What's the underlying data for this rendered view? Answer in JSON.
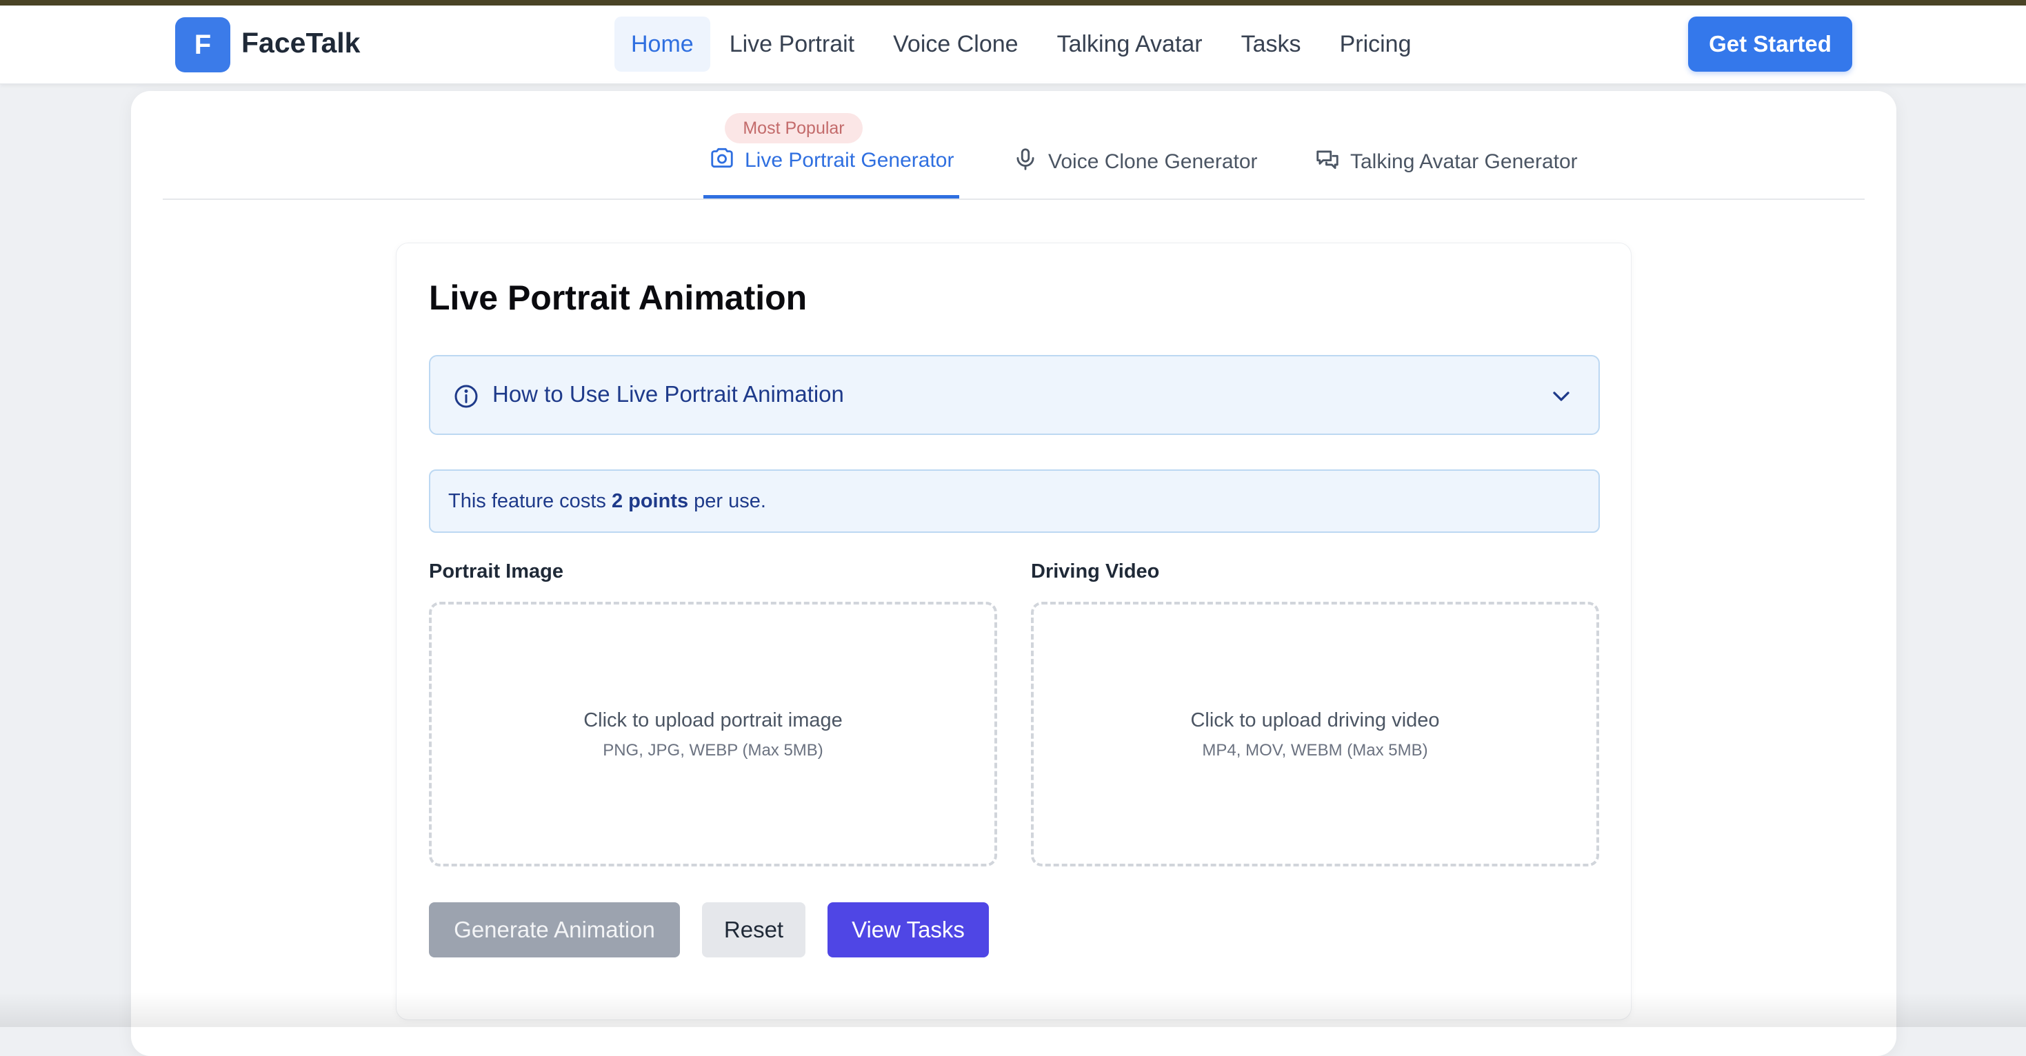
{
  "brand": {
    "logo_letter": "F",
    "name": "FaceTalk",
    "accent": "#3478eb"
  },
  "nav": {
    "links": [
      {
        "label": "Home",
        "active": true
      },
      {
        "label": "Live Portrait"
      },
      {
        "label": "Voice Clone"
      },
      {
        "label": "Talking Avatar"
      },
      {
        "label": "Tasks"
      },
      {
        "label": "Pricing"
      }
    ],
    "cta": "Get Started"
  },
  "tabs": {
    "items": [
      {
        "label": "Live Portrait Generator",
        "icon": "camera-icon",
        "active": true
      },
      {
        "label": "Voice Clone Generator",
        "icon": "microphone-icon"
      },
      {
        "label": "Talking Avatar Generator",
        "icon": "chat-bubbles-icon"
      }
    ],
    "badge": "Most Popular"
  },
  "panel": {
    "title": "Live Portrait Animation",
    "howto": "How to Use Live Portrait Animation",
    "cost": {
      "prefix": "This feature costs ",
      "points": "2 points",
      "suffix": " per use."
    },
    "portrait": {
      "label": "Portrait Image",
      "main": "Click to upload portrait image",
      "sub": "PNG, JPG, WEBP (Max 5MB)"
    },
    "video": {
      "label": "Driving Video",
      "main": "Click to upload driving video",
      "sub": "MP4, MOV, WEBM (Max 5MB)"
    },
    "buttons": {
      "generate": "Generate Animation",
      "reset": "Reset",
      "view": "View Tasks"
    }
  }
}
